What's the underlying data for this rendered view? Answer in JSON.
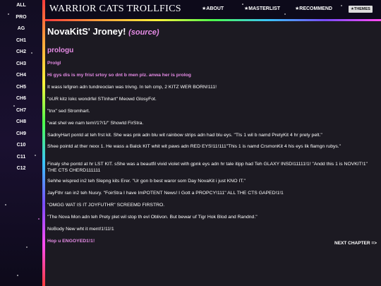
{
  "sidebar": {
    "items": [
      {
        "label": "ALL"
      },
      {
        "label": "PRO"
      },
      {
        "label": "AG"
      },
      {
        "label": "CH1"
      },
      {
        "label": "CH2"
      },
      {
        "label": "CH3"
      },
      {
        "label": "CH4"
      },
      {
        "label": "CH5"
      },
      {
        "label": "CH6"
      },
      {
        "label": "CH7"
      },
      {
        "label": "CH8"
      },
      {
        "label": "CH9"
      },
      {
        "label": "C10"
      },
      {
        "label": "C11"
      },
      {
        "label": "C12"
      }
    ]
  },
  "header": {
    "site_title": "WARRIOR CATS TROLLFICS",
    "nav": [
      {
        "label": "★ABOUT"
      },
      {
        "label": "★MASTERLIST"
      },
      {
        "label": "★RECOMMEND"
      }
    ],
    "themes_label": "★THEMES"
  },
  "main": {
    "title": "NovaKitS' Jroney!",
    "source_label": "(source)",
    "chapter_heading": "prologu",
    "paragraphs": [
      {
        "text": "Prolgl",
        "style": "pink"
      },
      {
        "text": "Hi gys dis is my frist srtoy so dnt b men plz. anwa her is prolog",
        "style": "pink"
      },
      {
        "text": "It wass lefgren adn tundreoclan was trivng. In teh cmp, 2 KITZ WER BORN!111!",
        "style": "normal"
      },
      {
        "text": "\"oUR kitz lokc wondrfel STInhart\" Meowd GlosyFot.",
        "style": "normal"
      },
      {
        "text": "\"tnx\" sed Stromhart.",
        "style": "normal"
      },
      {
        "text": "\"wat shel we nam tem!/1?/1/\" Showtd FirStra.",
        "style": "normal"
      },
      {
        "text": "SadnyHart pontd at teh frst kit. She was pnk adn blu wit rainbow strips adn had blu eys. \"TIs 1 wil b namd PretyKit 4 hr prety pelt.\"",
        "style": "normal"
      },
      {
        "text": "Shee pointd at ther nexx 1. He wass a Balck KIT whit wit paws adn RED EYS!11!111\"This 1 is namd CrsmonKit 4 his eys lik flamgn rubys.\"",
        "style": "normal"
      },
      {
        "text": "Finaly she pontd at hr LST KIT. sShe was a beautfil vivid violet with gpnk eys adn hr tale itipp had Teh GLAXY INSDI11111!1! \"Andd this 1 is NOVKIT!1\" THE CTS CHERD111111",
        "style": "normal"
      },
      {
        "text": "Sehhe wispred in2 teh Slepng kits Erer. \"Ur gon b best waror som Day NovaKit i just KNO IT.\"",
        "style": "normal"
      },
      {
        "text": "JayFthr ran in2 teh Nusry. \"FoirStra I have ImPOTENT News! I Gott a PROPCY!111\" ALL THE CTS GAPED!1!1",
        "style": "normal"
      },
      {
        "text": "\"OMGG WAT IS IT JOYFUTHR\" SCREEMD FIRSTRO.",
        "style": "normal"
      },
      {
        "text": "\"The Nova Mon adn teh Prety plet wil stop th evl Oblivon. But bewar uf Tigr Hok Blod and Randnd.\"",
        "style": "normal"
      },
      {
        "text": "NoBody New wht it ment!1!11!1",
        "style": "normal"
      },
      {
        "text": "Hop u ENGOYED1!1!",
        "style": "pink"
      }
    ],
    "next_chapter": "NEXT CHAPTER =>"
  },
  "colors": {
    "accent_pink": "#e58be5",
    "background": "#1c1a22",
    "sidebar_bg": "#0d0a1a"
  }
}
